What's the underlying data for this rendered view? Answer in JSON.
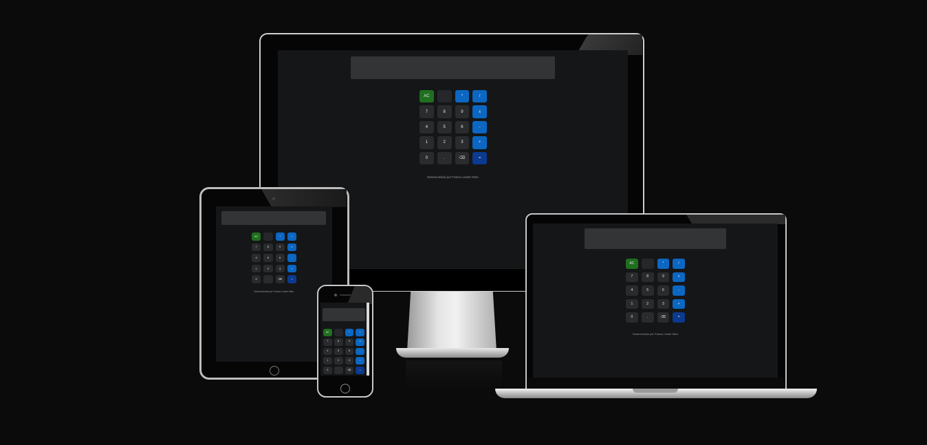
{
  "calculator": {
    "keys": [
      "AC",
      "",
      "*",
      "/",
      "7",
      "8",
      "9",
      "x",
      "4",
      "5",
      "6",
      "-",
      "1",
      "2",
      "3",
      "+",
      "0",
      ".",
      "⌫",
      "="
    ],
    "key_styles": [
      "green",
      "blank",
      "blue",
      "blue",
      "",
      "",
      "",
      "blue",
      "",
      "",
      "",
      "blue",
      "",
      "",
      "",
      "blue",
      "",
      "",
      "",
      "navy"
    ],
    "footer": "Desenvolvido por Franco Lester Nitro"
  },
  "colors": {
    "background": "#0b0b0c",
    "screen": "#151618",
    "display": "#333436",
    "key": "#2a2b2d",
    "green": "#1f6f1f",
    "blue": "#0b67c2",
    "navy": "#0b3a8f"
  },
  "icons": {
    "backspace": "backspace-icon"
  }
}
